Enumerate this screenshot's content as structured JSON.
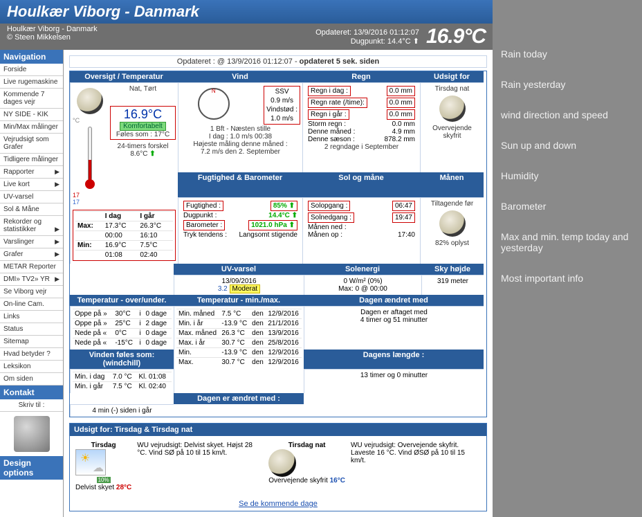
{
  "title": "Houlkær Viborg - Danmark",
  "sub_left_l1": "Houlkær Viborg - Danmark",
  "sub_left_l2": "© Steen Mikkelsen",
  "sub_right_l1": "Opdateret:  13/9/2016 01:12:07",
  "sub_right_l2": "Dugpunkt: 14.4°C ⬆",
  "big_temp": "16.9°C",
  "nav": {
    "head1": "Navigation",
    "items": [
      "Forside",
      "Live rugemaskine",
      "Kommende 7 dages vejr",
      "NY SIDE - KIK",
      "Min/Max målinger",
      "Vejrudsigt som Grafer",
      "Tidligere målinger",
      "Rapporter",
      "Live kort",
      "UV-varsel",
      "Sol & Måne",
      "Rekorder og statistikker",
      "Varslinger",
      "Grafer",
      "METAR Reporter",
      "DMI» TV2» YR",
      "Se Viborg vejr",
      "On-line Cam.",
      "Links",
      "Status",
      "Sitemap",
      "Hvad betyder ?",
      "Leksikon",
      "Om siden"
    ],
    "arrows": {
      "7": true,
      "8": true,
      "11": true,
      "12": true,
      "13": true,
      "15": true
    },
    "head2": "Kontakt",
    "skriv": "Skriv til :",
    "head3": "Design options"
  },
  "upd_line_prefix": "Opdateret : @ 13/9/2016 01:12:07 - ",
  "upd_line_bold": "opdateret 5 sek. siden",
  "hdr": {
    "overview": "Oversigt / Temperatur",
    "wind": "Vind",
    "rain": "Regn",
    "outlook": "Udsigt for",
    "humid": "Fugtighed & Barometer",
    "sun": "Sol og måne",
    "moon": "Månen",
    "uv": "UV-varsel",
    "solar": "Solenergi",
    "sky": "Sky højde",
    "tover": "Temperatur - over/under.",
    "tminmax": "Temperatur - min./max.",
    "daych": "Dagen ændret med",
    "daylen": "Dagens længde :",
    "daychy": "Dagen er ændret med :",
    "windchill": "Vinden føles som: (windchill)",
    "forecast": "Udsigt for:   Tirsdag & Tirsdag nat"
  },
  "overview": {
    "cond": "Nat, Tørt",
    "temp": "16.9°C",
    "comfort": "Komfortabelt",
    "feels": "Føles som : 17°C",
    "diff": "24-timers forskel 8.6°C",
    "therm_lo": "17",
    "therm_hi": "17",
    "minmax": {
      "h1": "I dag",
      "h2": "I går",
      "r1a": "Max:",
      "r1b": "17.3°C",
      "r1c": "26.3°C",
      "r2b": "00:00",
      "r2c": "16:10",
      "r3a": "Min:",
      "r3b": "16.9°C",
      "r3c": "7.5°C",
      "r4b": "01:08",
      "r4c": "02:40"
    }
  },
  "wind": {
    "box1": "SSV",
    "box2": "0.9 m/s",
    "box3": "Vindstød :",
    "box4": "1.0 m/s",
    "bft": "1 Bft - Næsten stille",
    "l1": "I dag :    1.0 m/s   00:38",
    "l2": "Højeste måling denne måned :",
    "l3": "7.2 m/s den 2. September"
  },
  "rain": {
    "r1l": "Regn i dag :",
    "r1v": "0.0 mm",
    "r2l": "Regn rate (/time):",
    "r2v": "0.0 mm",
    "r3l": "Regn i går :",
    "r3v": "0.0 mm",
    "r4l": "Storm regn :",
    "r4v": "0.0 mm",
    "r5l": "Denne måned :",
    "r5v": "4.9 mm",
    "r6l": "Denne sæson :",
    "r6v": "878.2 mm",
    "r7": "2 regndage i September"
  },
  "outlook": {
    "lbl": "Tirsdag nat",
    "desc": "Overvejende skyfrit"
  },
  "humid": {
    "h1l": "Fugtighed :",
    "h1v": "85% ⬆",
    "h2l": "Dugpunkt :",
    "h2v": "14.4°C ⬆",
    "h3l": "Barometer :",
    "h3v": "1021.0 hPa ⬆",
    "h4l": "Tryk tendens :",
    "h4v": "Langsomt stigende"
  },
  "sun": {
    "s1l": "Solopgang :",
    "s1v": "06:47",
    "s2l": "Solnedgang :",
    "s2v": "19:47",
    "s3l": "Månen ned :",
    "s3v": "",
    "s4l": "Månen op :",
    "s4v": "17:40"
  },
  "moon": {
    "phase": "Tiltagende før",
    "pct": "82% oplyst"
  },
  "uv": {
    "date": "13/09/2016",
    "val": "3.2",
    "level": "Moderat"
  },
  "solar": {
    "l1": "0 W/m² (0%)",
    "l2": "Max: 0 @ 00:00"
  },
  "sky": {
    "v": "319 meter"
  },
  "tover": {
    "r1": [
      "Oppe på »",
      "30°C",
      "i",
      "0 dage"
    ],
    "r2": [
      "Oppe på »",
      "25°C",
      "i",
      "2 dage"
    ],
    "r3": [
      "Nede på «",
      "0°C",
      "i",
      "0 dage"
    ],
    "r4": [
      "Nede på «",
      "-15°C",
      "i",
      "0 dage"
    ]
  },
  "tminmax": {
    "r1": [
      "Min. måned",
      "7.5 °C",
      "den",
      "12/9/2016"
    ],
    "r2": [
      "Min. i år",
      "-13.9 °C",
      "den",
      "21/1/2016"
    ],
    "r3": [
      "Max. måned",
      "26.3 °C",
      "den",
      "13/9/2016"
    ],
    "r4": [
      "Max. i år",
      "30.7 °C",
      "den",
      "25/8/2016"
    ],
    "r5": [
      "Min.",
      "-13.9 °C",
      "den",
      "12/9/2016"
    ],
    "r6": [
      "Max.",
      "30.7 °C",
      "den",
      "12/9/2016"
    ]
  },
  "daych": {
    "l1": "Dagen er aftaget med",
    "l2": "4 timer og 51 minutter",
    "l3": "13 timer og 0 minutter",
    "l4": "4 min (-) siden i går"
  },
  "windchill": {
    "r1": [
      "Min. i dag",
      "7.0 °C",
      "Kl. 01:08"
    ],
    "r2": [
      "Min. i går",
      "7.5 °C",
      "Kl. 02:40"
    ]
  },
  "forecast": {
    "d1_name": "Tirsdag",
    "d1_pct": "10%",
    "d1_cond": "Delvist skyet",
    "d1_t": "28°C",
    "d1_text": "WU vejrudsigt: Delvist skyet. Højst 28 °C. Vind SØ på 10 til 15 km/t.",
    "d2_name": "Tirsdag nat",
    "d2_cond": "Overvejende skyfrit",
    "d2_t": "16°C",
    "d2_text": "WU vejrudsigt: Overvejende skyfrit. Laveste 16 °C. Vind ØSØ på 10 til 15 km/t.",
    "link": "Se de kommende dage"
  },
  "anno": [
    "Rain today",
    "Rain yesterday",
    "wind direction and speed",
    "Sun up and down",
    "Humidity",
    "Barometer",
    "Max and min. temp today and yesterday",
    "Most important info"
  ]
}
